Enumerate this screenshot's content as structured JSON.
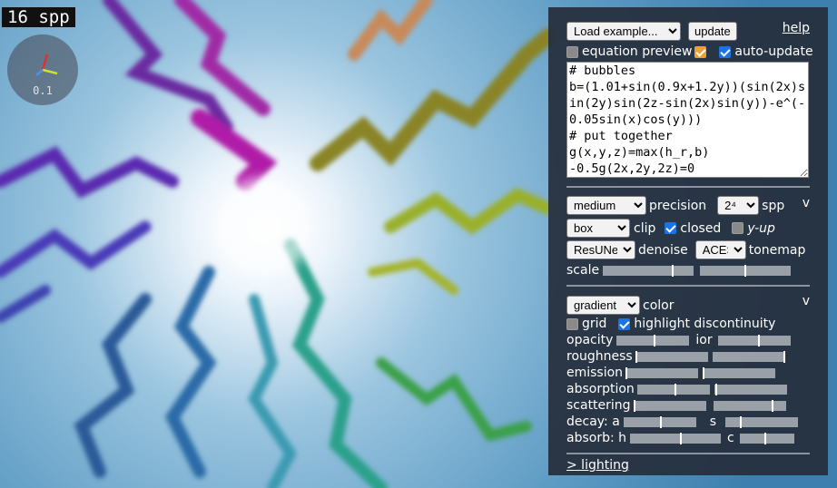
{
  "viewport": {
    "spp_counter": "16 spp",
    "axes_scale": "0.1"
  },
  "panel": {
    "example_select": "Load example...",
    "update_button": "update",
    "help_link": "help",
    "equation_preview_label": "equation preview",
    "equation_preview_checked": false,
    "auto_update_label": "auto-update",
    "auto_update_checked": true,
    "equation_text": "# bubbles\nb=(1.01+sin(0.9x+1.2y))(sin(2x)sin(2y)sin(2z-sin(2x)sin(y))-e^(-0.05sin(x)cos(y)))\n# put together\ng(x,y,z)=max(h_r,b)\n-0.5g(2x,2y,2z)=0",
    "render": {
      "quality_select": "medium",
      "precision_label": "precision",
      "spp_select": "2⁴",
      "spp_label": "spp",
      "collapse_toggle": "v",
      "clip_select": "box",
      "clip_label": "clip",
      "closed_label": "closed",
      "closed_checked": true,
      "yup_label": "y-up",
      "yup_checked": false,
      "denoise_select": "ResUNet",
      "denoise_label": "denoise",
      "tonemap_select": "ACES",
      "tonemap_label": "tonemap",
      "scale_label": "scale",
      "scale_values": [
        0.77,
        0.5
      ]
    },
    "material": {
      "color_select": "gradient",
      "color_label": "color",
      "collapse_toggle": "v",
      "grid_label": "grid",
      "grid_checked": false,
      "highlight_label": "highlight discontinuity",
      "highlight_checked": true,
      "opacity_label": "opacity",
      "opacity_value": 0.52,
      "ior_label": "ior",
      "ior_value": 0.55,
      "roughness_label": "roughness",
      "roughness_value": 0.0,
      "roughness2_value": 0.98,
      "emission_label": "emission",
      "emission_value": 0.0,
      "emission2_value": 0.0,
      "absorption_label": "absorption",
      "absorption_value": 0.52,
      "absorption2_value": 0.02,
      "scattering_label": "scattering",
      "scattering_value": 0.0,
      "scattering2_value": 0.8,
      "decay_a_label": "decay: a",
      "decay_a_value": 0.5,
      "decay_s_label": "s",
      "decay_s_value": 0.2,
      "absorb_h_label": "absorb: h",
      "absorb_h_value": 0.55,
      "absorb_c_label": "c",
      "absorb_c_value": 0.45
    },
    "lighting_link": "> lighting"
  },
  "colors": {
    "panel_bg": "#262e3c",
    "checkbox_on": "#1a73e8",
    "checkbox_preview": "#f0a030"
  }
}
